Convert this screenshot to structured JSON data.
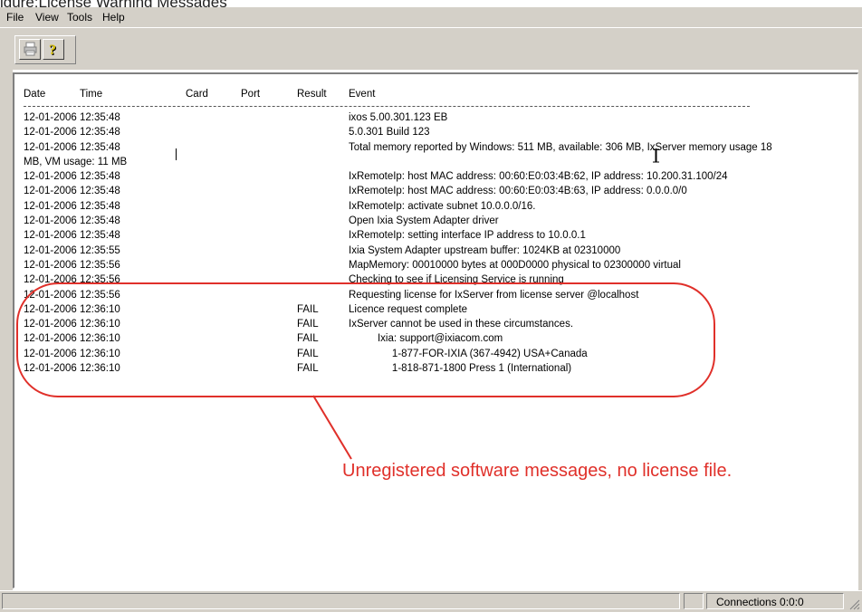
{
  "caption": "igure:License Warning Messages",
  "menu": [
    "File",
    "View",
    "Tools",
    "Help"
  ],
  "toolbar": {
    "buttons": [
      {
        "name": "print-icon"
      },
      {
        "name": "help-icon"
      }
    ]
  },
  "log": {
    "headers": {
      "date": "Date",
      "time": "Time",
      "card": "Card",
      "port": "Port",
      "result": "Result",
      "event": "Event"
    },
    "rows": [
      {
        "datetime": "12-01-2006 12:35:48",
        "result": "",
        "event": "ixos 5.00.301.123 EB"
      },
      {
        "datetime": "12-01-2006 12:35:48",
        "result": "",
        "event": "5.0.301 Build 123"
      },
      {
        "datetime": "12-01-2006 12:35:48",
        "result": "",
        "event": "Total memory reported by Windows: 511 MB, available: 306 MB, IxServer memory usage 18"
      },
      {
        "wrap": "MB, VM usage: 11 MB"
      },
      {
        "datetime": "12-01-2006 12:35:48",
        "result": "",
        "event": "IxRemoteIp: host MAC address: 00:60:E0:03:4B:62, IP address: 10.200.31.100/24"
      },
      {
        "datetime": "12-01-2006 12:35:48",
        "result": "",
        "event": "IxRemoteIp: host MAC address: 00:60:E0:03:4B:63, IP address: 0.0.0.0/0"
      },
      {
        "datetime": "12-01-2006 12:35:48",
        "result": "",
        "event": "IxRemoteIp: activate subnet 10.0.0.0/16."
      },
      {
        "datetime": "12-01-2006 12:35:48",
        "result": "",
        "event": "Open Ixia System Adapter driver"
      },
      {
        "datetime": "12-01-2006 12:35:48",
        "result": "",
        "event": "IxRemoteIp: setting interface IP address to 10.0.0.1"
      },
      {
        "datetime": "12-01-2006 12:35:55",
        "result": "",
        "event": "Ixia System Adapter upstream buffer: 1024KB at 02310000"
      },
      {
        "datetime": "12-01-2006 12:35:56",
        "result": "",
        "event": "MapMemory: 00010000 bytes at 000D0000 physical to 02300000 virtual"
      },
      {
        "datetime": "12-01-2006 12:35:56",
        "result": "",
        "event": "Checking to see if Licensing Service is running"
      },
      {
        "datetime": "12-01-2006 12:35:56",
        "result": "",
        "event": "Requesting license for IxServer from license server @localhost"
      },
      {
        "datetime": "12-01-2006 12:36:10",
        "result": "FAIL",
        "event": "Licence request complete"
      },
      {
        "datetime": "12-01-2006 12:36:10",
        "result": "FAIL",
        "event": "IxServer cannot be used in these circumstances."
      },
      {
        "datetime": "12-01-2006 12:36:10",
        "result": "FAIL",
        "event": "          Ixia: support@ixiacom.com"
      },
      {
        "datetime": "12-01-2006 12:36:10",
        "result": "FAIL",
        "event": "               1-877-FOR-IXIA (367-4942) USA+Canada"
      },
      {
        "datetime": "12-01-2006 12:36:10",
        "result": "FAIL",
        "event": "               1-818-871-1800 Press 1 (International)"
      }
    ]
  },
  "annotation": "Unregistered software messages, no license file.",
  "statusbar": {
    "connections": "Connections 0:0:0"
  },
  "colors": {
    "annotation": "#e0302a",
    "chrome": "#d4d0c8"
  }
}
